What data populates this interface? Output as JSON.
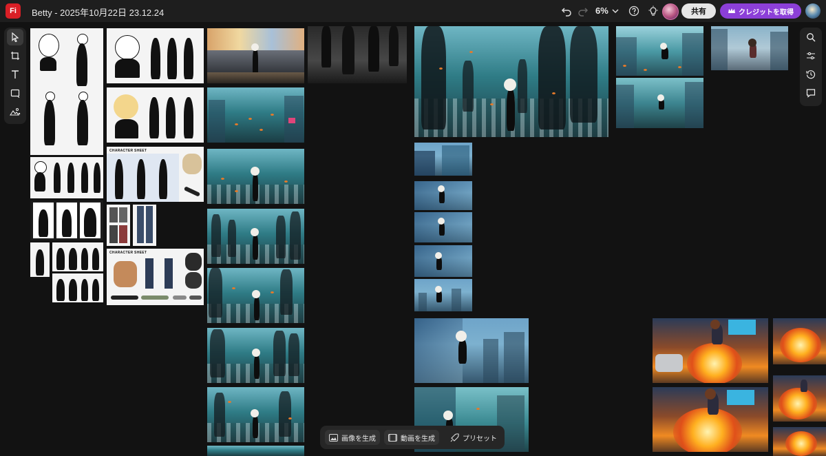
{
  "app": {
    "logo_text": "Fi",
    "document_title": "Betty - 2025年10月22日 23.12.24",
    "brand_color": "#d91f26"
  },
  "header": {
    "undo_icon": "undo-icon",
    "redo_icon": "redo-icon",
    "zoom_level": "6%",
    "help_icon": "help-icon",
    "tips_icon": "lightbulb-icon",
    "share_label": "共有",
    "credit_label": "クレジットを取得",
    "credit_color": "#8c3fd8"
  },
  "left_tools": [
    {
      "name": "select-tool",
      "icon": "pointer-icon"
    },
    {
      "name": "crop-tool",
      "icon": "crop-icon"
    },
    {
      "name": "text-tool",
      "icon": "text-icon"
    },
    {
      "name": "shape-tool",
      "icon": "rectangle-icon"
    },
    {
      "name": "generate-fill-tool",
      "icon": "image-fill-icon"
    }
  ],
  "right_tools": [
    {
      "name": "search-tool",
      "icon": "search-icon"
    },
    {
      "name": "adjust-tool",
      "icon": "sliders-icon"
    },
    {
      "name": "history-tool",
      "icon": "history-icon"
    },
    {
      "name": "comment-tool",
      "icon": "comment-icon"
    }
  ],
  "canvas": {
    "sheet_labels": {
      "character_sheet_1": "CHARACTER SHEET",
      "character_sheet_2": "CHARACTER SHEET"
    }
  },
  "bottom_bar": {
    "generate_image_label": "画像を生成",
    "generate_video_label": "動画を生成",
    "preset_label": "プリセット"
  }
}
